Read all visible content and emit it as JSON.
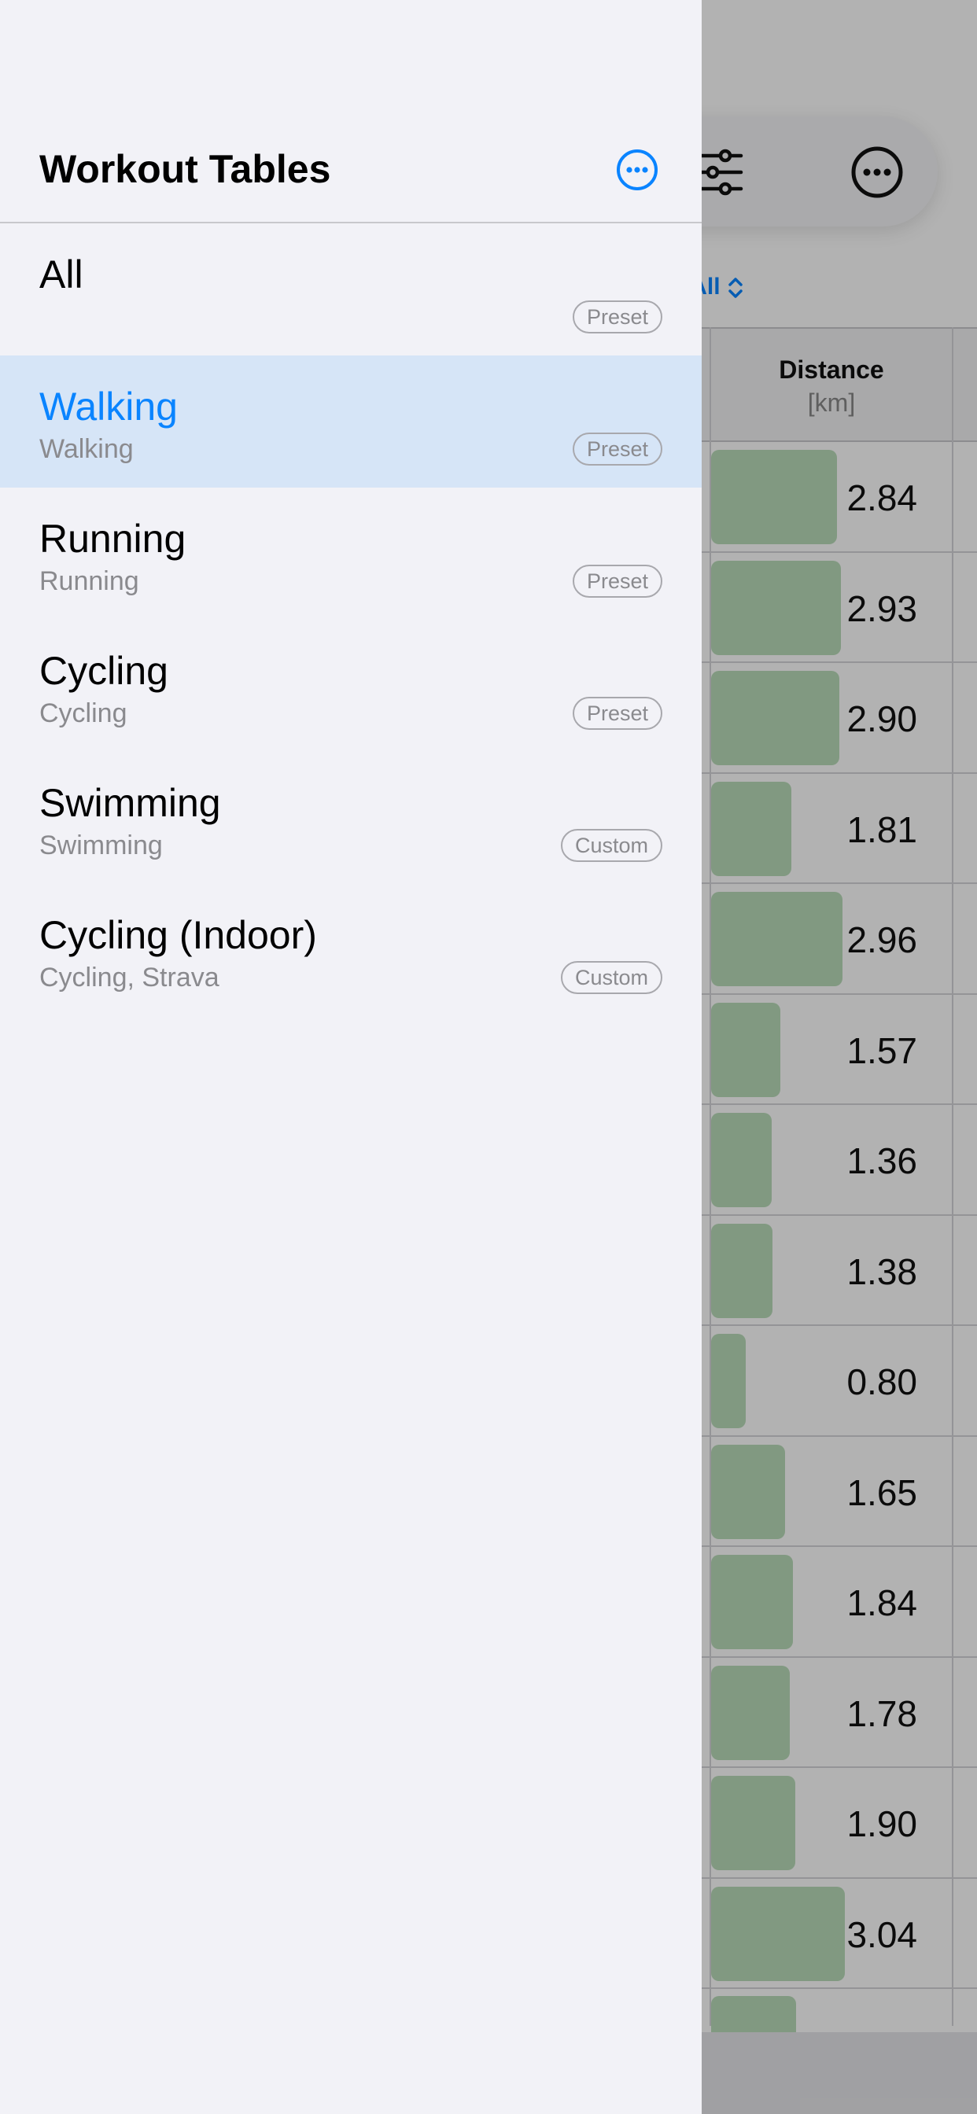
{
  "sidebar": {
    "title": "Workout Tables",
    "items": [
      {
        "title": "All",
        "subtitle": "",
        "badge": "Preset",
        "selected": false
      },
      {
        "title": "Walking",
        "subtitle": "Walking",
        "badge": "Preset",
        "selected": true
      },
      {
        "title": "Running",
        "subtitle": "Running",
        "badge": "Preset",
        "selected": false
      },
      {
        "title": "Cycling",
        "subtitle": "Cycling",
        "badge": "Preset",
        "selected": false
      },
      {
        "title": "Swimming",
        "subtitle": "Swimming",
        "badge": "Custom",
        "selected": false
      },
      {
        "title": "Cycling (Indoor)",
        "subtitle": "Cycling, Strava",
        "badge": "Custom",
        "selected": false
      }
    ]
  },
  "background": {
    "filter_label": ": All",
    "column": {
      "title": "Distance",
      "unit": "[km]"
    },
    "rows": [
      {
        "value": "2.84",
        "fraction": 0.94
      },
      {
        "value": "2.93",
        "fraction": 0.97
      },
      {
        "value": "2.90",
        "fraction": 0.96
      },
      {
        "value": "1.81",
        "fraction": 0.6
      },
      {
        "value": "2.96",
        "fraction": 0.98
      },
      {
        "value": "1.57",
        "fraction": 0.52
      },
      {
        "value": "1.36",
        "fraction": 0.45
      },
      {
        "value": "1.38",
        "fraction": 0.46
      },
      {
        "value": "0.80",
        "fraction": 0.26
      },
      {
        "value": "1.65",
        "fraction": 0.55
      },
      {
        "value": "1.84",
        "fraction": 0.61
      },
      {
        "value": "1.78",
        "fraction": 0.59
      },
      {
        "value": "1.90",
        "fraction": 0.63
      },
      {
        "value": "3.04",
        "fraction": 1.0
      }
    ]
  },
  "colors": {
    "accent": "#0a84ff",
    "selected_row": "#d6e5f7",
    "bar": "#b9dcb9"
  },
  "icons": [
    "more-circle-icon",
    "sliders-icon",
    "chevron-up-down-icon"
  ]
}
